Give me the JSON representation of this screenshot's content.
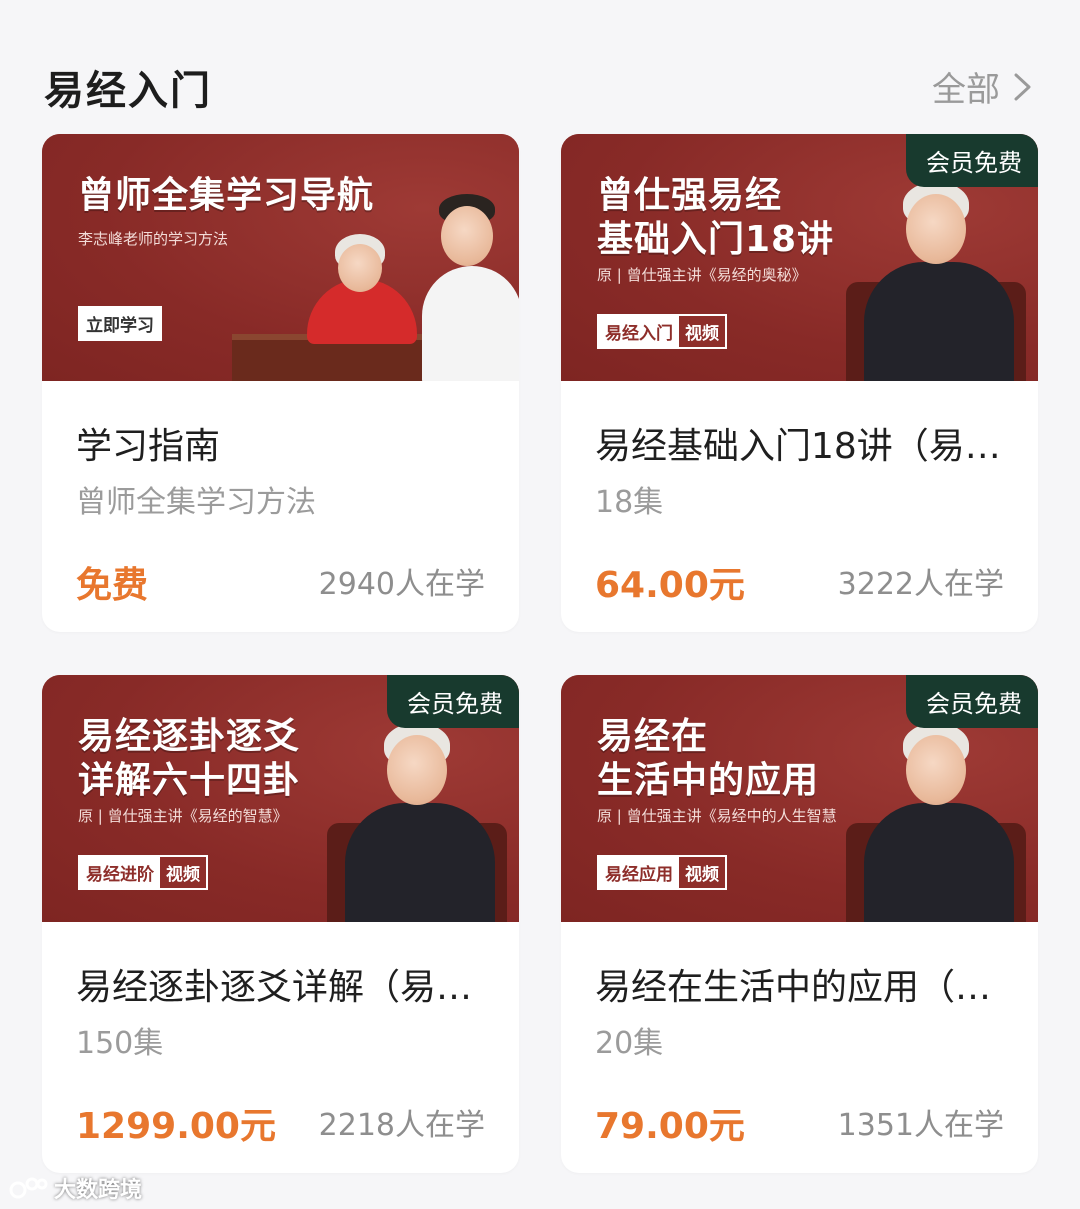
{
  "section": {
    "title": "易经入门",
    "see_all": "全部"
  },
  "courses": [
    {
      "cover_title": "曾师全集学习导航",
      "cover_subtitle": "李志峰老师的学习方法",
      "cover_tag_1": "立即学习",
      "cover_tag_2": "",
      "badge": "",
      "title": "学习指南",
      "meta": "曾师全集学习方法",
      "price": "免费",
      "learners": "2940人在学"
    },
    {
      "cover_title": "曾仕强易经\n基础入门18讲",
      "cover_subtitle": "原 | 曾仕强主讲《易经的奥秘》",
      "cover_tag_1": "易经入门",
      "cover_tag_2": "视频",
      "badge": "会员免费",
      "title": "易经基础入门18讲（易…",
      "meta": "18集",
      "price": "64.00元",
      "learners": "3222人在学"
    },
    {
      "cover_title": "易经逐卦逐爻\n详解六十四卦",
      "cover_subtitle": "原 | 曾仕强主讲《易经的智慧》",
      "cover_tag_1": "易经进阶",
      "cover_tag_2": "视频",
      "badge": "会员免费",
      "title": "易经逐卦逐爻详解（易…",
      "meta": "150集",
      "price": "1299.00元",
      "learners": "2218人在学"
    },
    {
      "cover_title": "易经在\n生活中的应用",
      "cover_subtitle": "原 | 曾仕强主讲《易经中的人生智慧",
      "cover_tag_1": "易经应用",
      "cover_tag_2": "视频",
      "badge": "会员免费",
      "title": "易经在生活中的应用（…",
      "meta": "20集",
      "price": "79.00元",
      "learners": "1351人在学"
    }
  ],
  "watermark": "大数跨境",
  "colors": {
    "price": "#e8772e",
    "cover_bg": "#8e2e2a",
    "badge_bg": "#183a2e"
  }
}
